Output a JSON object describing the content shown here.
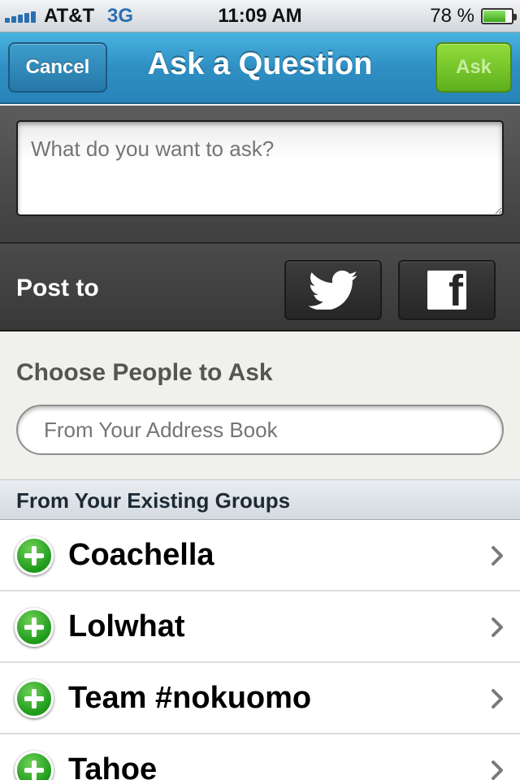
{
  "status_bar": {
    "carrier": "AT&T",
    "network": "3G",
    "time": "11:09 AM",
    "battery_percent": "78 %",
    "battery_level": 0.78,
    "signal_bars": 5
  },
  "nav": {
    "title": "Ask a Question",
    "cancel_label": "Cancel",
    "ask_label": "Ask"
  },
  "question": {
    "placeholder": "What do you want to ask?",
    "value": ""
  },
  "post_to": {
    "label": "Post to",
    "services": [
      "twitter-icon",
      "facebook-icon"
    ]
  },
  "choose_people": {
    "title": "Choose People to Ask",
    "address_placeholder": "From Your Address Book"
  },
  "groups": {
    "header": "From Your Existing Groups",
    "items": [
      {
        "label": "Coachella"
      },
      {
        "label": "Lolwhat"
      },
      {
        "label": "Team #nokuomo"
      },
      {
        "label": "Tahoe"
      }
    ]
  },
  "colors": {
    "nav_blue": "#2f8fc3",
    "ask_green": "#6cbf24",
    "add_green": "#1d9a1a"
  }
}
